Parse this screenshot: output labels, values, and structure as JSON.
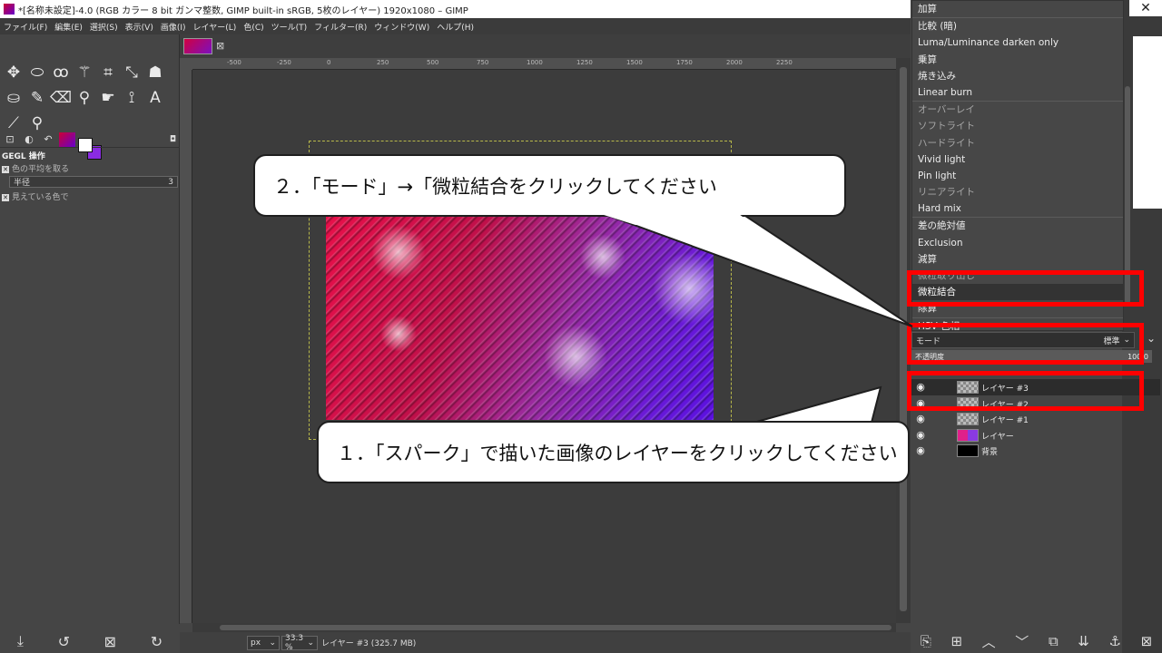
{
  "window": {
    "title": "*[名称未設定]-4.0 (RGB カラー 8 bit ガンマ整数, GIMP built-in sRGB, 5枚のレイヤー) 1920x1080 – GIMP",
    "close_glyph": "✕"
  },
  "menubar": [
    "ファイル(F)",
    "編集(E)",
    "選択(S)",
    "表示(V)",
    "画像(I)",
    "レイヤー(L)",
    "色(C)",
    "ツール(T)",
    "フィルター(R)",
    "ウィンドウ(W)",
    "ヘルプ(H)"
  ],
  "tool_options": {
    "title": "GEGL 操作",
    "sample_average_label": "色の平均を取る",
    "radius_label": "半径",
    "radius_value": "3",
    "sample_merged_label": "見えている色で"
  },
  "ruler": {
    "ticks": [
      "-500",
      "-250",
      "0",
      "250",
      "500",
      "750",
      "1000",
      "1250",
      "1500",
      "1750",
      "2000",
      "2250"
    ]
  },
  "statusbar": {
    "unit": "px",
    "zoom": "33.3 %",
    "info": "レイヤー #3 (325.7 MB)"
  },
  "mode_menu": {
    "items": [
      {
        "label": "加算",
        "dim": false
      },
      {
        "sep": true
      },
      {
        "label": "比較 (暗)",
        "dim": false
      },
      {
        "label": "Luma/Luminance darken only",
        "dim": false
      },
      {
        "label": "乗算",
        "dim": false
      },
      {
        "label": "焼き込み",
        "dim": false
      },
      {
        "label": "Linear burn",
        "dim": false
      },
      {
        "sep": true
      },
      {
        "label": "オーバーレイ",
        "dim": true
      },
      {
        "label": "ソフトライト",
        "dim": true
      },
      {
        "label": "ハードライト",
        "dim": true
      },
      {
        "label": "Vivid light",
        "dim": false
      },
      {
        "label": "Pin light",
        "dim": false
      },
      {
        "label": "リニアライト",
        "dim": true
      },
      {
        "label": "Hard mix",
        "dim": false
      },
      {
        "sep": true
      },
      {
        "label": "差の絶対値",
        "dim": false
      },
      {
        "label": "Exclusion",
        "dim": false
      },
      {
        "label": "減算",
        "dim": false
      },
      {
        "label": "微粒取り出し",
        "dim": true
      },
      {
        "label": "微粒結合",
        "dim": false,
        "selected": true
      },
      {
        "label": "除算",
        "dim": false
      },
      {
        "sep": true
      },
      {
        "label": "HSV 色相",
        "dim": false
      }
    ]
  },
  "layers_panel": {
    "mode_label": "モード",
    "mode_value": "標準",
    "opacity_label": "不透明度",
    "opacity_value": "100.0",
    "layers": [
      {
        "name": "レイヤー #3",
        "thumb": "checker",
        "active": true
      },
      {
        "name": "レイヤー #2",
        "thumb": "checker",
        "active": false
      },
      {
        "name": "レイヤー #1",
        "thumb": "checker",
        "active": false
      },
      {
        "name": "レイヤー",
        "thumb": "pink",
        "active": false
      },
      {
        "name": "背景",
        "thumb": "black",
        "active": false
      }
    ]
  },
  "callouts": {
    "step2": "２．「モード」→「微粒結合をクリックしてください",
    "step1": "１．「スパーク」で描いた画像のレイヤーをクリックしてください"
  },
  "colors": {
    "highlight": "#ff0000",
    "foreground": "#ffffff",
    "background": "#8a2be2"
  }
}
